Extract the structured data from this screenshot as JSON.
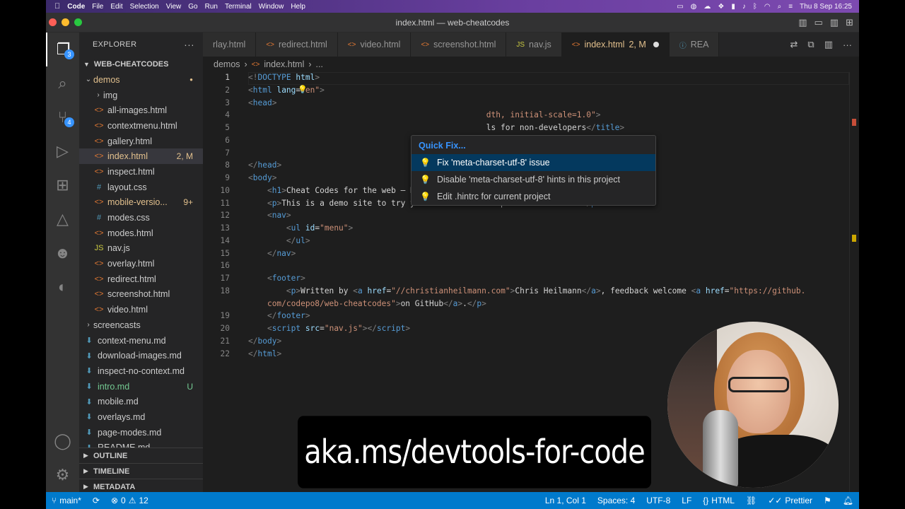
{
  "menubar": {
    "app": "Code",
    "items": [
      "File",
      "Edit",
      "Selection",
      "View",
      "Go",
      "Run",
      "Terminal",
      "Window",
      "Help"
    ],
    "clock": "Thu 8 Sep  16:25"
  },
  "window": {
    "title": "index.html — web-cheatcodes"
  },
  "activity": {
    "explorer_badge": "3",
    "scm_badge": "4"
  },
  "sidebar": {
    "title": "EXPLORER",
    "root": "WEB-CHEATCODES",
    "items": [
      {
        "label": "demos",
        "kind": "dir-open",
        "status": "dot"
      },
      {
        "label": "img",
        "kind": "dir"
      },
      {
        "label": "all-images.html",
        "kind": "html"
      },
      {
        "label": "contextmenu.html",
        "kind": "html"
      },
      {
        "label": "gallery.html",
        "kind": "html"
      },
      {
        "label": "index.html",
        "kind": "html",
        "status": "2, M"
      },
      {
        "label": "inspect.html",
        "kind": "html"
      },
      {
        "label": "layout.css",
        "kind": "css"
      },
      {
        "label": "mobile-versio...",
        "kind": "html",
        "status": "9+"
      },
      {
        "label": "modes.css",
        "kind": "css"
      },
      {
        "label": "modes.html",
        "kind": "html"
      },
      {
        "label": "nav.js",
        "kind": "js"
      },
      {
        "label": "overlay.html",
        "kind": "html"
      },
      {
        "label": "redirect.html",
        "kind": "html"
      },
      {
        "label": "screenshot.html",
        "kind": "html"
      },
      {
        "label": "video.html",
        "kind": "html"
      },
      {
        "label": "screencasts",
        "kind": "dir"
      },
      {
        "label": "context-menu.md",
        "kind": "md"
      },
      {
        "label": "download-images.md",
        "kind": "md"
      },
      {
        "label": "inspect-no-context.md",
        "kind": "md"
      },
      {
        "label": "intro.md",
        "kind": "md",
        "status": "U"
      },
      {
        "label": "mobile.md",
        "kind": "md"
      },
      {
        "label": "overlays.md",
        "kind": "md"
      },
      {
        "label": "page-modes.md",
        "kind": "md"
      },
      {
        "label": "README.md",
        "kind": "md"
      }
    ],
    "sections": [
      "OUTLINE",
      "TIMELINE",
      "METADATA"
    ]
  },
  "tabs": [
    {
      "label": "rlay.html",
      "kind": "html"
    },
    {
      "label": "redirect.html",
      "kind": "html"
    },
    {
      "label": "video.html",
      "kind": "html"
    },
    {
      "label": "screenshot.html",
      "kind": "html"
    },
    {
      "label": "nav.js",
      "kind": "js"
    },
    {
      "label": "index.html",
      "kind": "html",
      "status": "2, M",
      "active": true
    },
    {
      "label": "REA",
      "kind": "md"
    }
  ],
  "breadcrumb": [
    "demos",
    "index.html",
    "..."
  ],
  "quickfix": {
    "title": "Quick Fix...",
    "items": [
      "Fix 'meta-charset-utf-8' issue",
      "Disable 'meta-charset-utf-8' hints in this project",
      "Edit .hintrc for current project"
    ]
  },
  "code": {
    "lines": [
      [
        [
          "pn",
          "<!"
        ],
        [
          "tg",
          "DOCTYPE"
        ],
        [
          "tx",
          " "
        ],
        [
          "at",
          "html"
        ],
        [
          "pn",
          ">"
        ]
      ],
      [
        [
          "pn",
          "<"
        ],
        [
          "tg",
          "html"
        ],
        [
          "tx",
          " "
        ],
        [
          "at",
          "lang"
        ],
        [
          "tx",
          "="
        ],
        [
          "st",
          "\"en\""
        ],
        [
          "pn",
          ">"
        ]
      ],
      [
        [
          "pn",
          "<"
        ],
        [
          "tg",
          "head"
        ],
        [
          "pn",
          ">"
        ]
      ],
      [
        [
          "tx",
          "                                                  "
        ],
        [
          "st",
          "dth, initial-scale=1.0\""
        ],
        [
          "pn",
          ">"
        ]
      ],
      [
        [
          "tx",
          "                                                  "
        ],
        [
          "tx",
          "ls for non-developers"
        ],
        [
          "pn",
          "</"
        ],
        [
          "tg",
          "title"
        ],
        [
          "pn",
          ">"
        ]
      ],
      [
        [
          "tx",
          ""
        ]
      ],
      [
        [
          "tx",
          ""
        ]
      ],
      [
        [
          "pn",
          "</"
        ],
        [
          "tg",
          "head"
        ],
        [
          "pn",
          ">"
        ]
      ],
      [
        [
          "pn",
          "<"
        ],
        [
          "tg",
          "body"
        ],
        [
          "pn",
          ">"
        ]
      ],
      [
        [
          "tx",
          "    "
        ],
        [
          "pn",
          "<"
        ],
        [
          "tg",
          "h1"
        ],
        [
          "pn",
          ">"
        ],
        [
          "tx",
          "Cheat Codes for the web – Developer Tools for non-developers"
        ],
        [
          "pn",
          "</"
        ],
        [
          "tg",
          "h1"
        ],
        [
          "pn",
          ">"
        ]
      ],
      [
        [
          "tx",
          "    "
        ],
        [
          "pn",
          "<"
        ],
        [
          "tg",
          "p"
        ],
        [
          "pn",
          ">"
        ],
        [
          "tx",
          "This is a demo site to try your browser developer tools skills."
        ],
        [
          "pn",
          "</"
        ],
        [
          "tg",
          "p"
        ],
        [
          "pn",
          ">"
        ]
      ],
      [
        [
          "tx",
          "    "
        ],
        [
          "pn",
          "<"
        ],
        [
          "tg",
          "nav"
        ],
        [
          "pn",
          ">"
        ]
      ],
      [
        [
          "tx",
          "        "
        ],
        [
          "pn",
          "<"
        ],
        [
          "tg",
          "ul"
        ],
        [
          "tx",
          " "
        ],
        [
          "at",
          "id"
        ],
        [
          "tx",
          "="
        ],
        [
          "st",
          "\"menu\""
        ],
        [
          "pn",
          ">"
        ]
      ],
      [
        [
          "tx",
          "        "
        ],
        [
          "pn",
          "</"
        ],
        [
          "tg",
          "ul"
        ],
        [
          "pn",
          ">"
        ]
      ],
      [
        [
          "tx",
          "    "
        ],
        [
          "pn",
          "</"
        ],
        [
          "tg",
          "nav"
        ],
        [
          "pn",
          ">"
        ]
      ],
      [
        [
          "tx",
          ""
        ]
      ],
      [
        [
          "tx",
          "    "
        ],
        [
          "pn",
          "<"
        ],
        [
          "tg",
          "footer"
        ],
        [
          "pn",
          ">"
        ]
      ],
      [
        [
          "tx",
          "        "
        ],
        [
          "pn",
          "<"
        ],
        [
          "tg",
          "p"
        ],
        [
          "pn",
          ">"
        ],
        [
          "tx",
          "Written by "
        ],
        [
          "pn",
          "<"
        ],
        [
          "tg",
          "a"
        ],
        [
          "tx",
          " "
        ],
        [
          "at",
          "href"
        ],
        [
          "tx",
          "="
        ],
        [
          "st",
          "\"//christianheilmann.com\""
        ],
        [
          "pn",
          ">"
        ],
        [
          "tx",
          "Chris Heilmann"
        ],
        [
          "pn",
          "</"
        ],
        [
          "tg",
          "a"
        ],
        [
          "pn",
          ">"
        ],
        [
          "tx",
          ", feedback welcome "
        ],
        [
          "pn",
          "<"
        ],
        [
          "tg",
          "a"
        ],
        [
          "tx",
          " "
        ],
        [
          "at",
          "href"
        ],
        [
          "tx",
          "="
        ],
        [
          "st",
          "\"https://github."
        ]
      ],
      [
        [
          "tx",
          "    "
        ],
        [
          "st",
          "com/codepo8/web-cheatcodes\""
        ],
        [
          "pn",
          ">"
        ],
        [
          "tx",
          "on GitHub"
        ],
        [
          "pn",
          "</"
        ],
        [
          "tg",
          "a"
        ],
        [
          "pn",
          ">"
        ],
        [
          "tx",
          "."
        ],
        [
          "pn",
          "</"
        ],
        [
          "tg",
          "p"
        ],
        [
          "pn",
          ">"
        ]
      ],
      [
        [
          "tx",
          "    "
        ],
        [
          "pn",
          "</"
        ],
        [
          "tg",
          "footer"
        ],
        [
          "pn",
          ">"
        ]
      ],
      [
        [
          "tx",
          "    "
        ],
        [
          "pn",
          "<"
        ],
        [
          "tg",
          "script"
        ],
        [
          "tx",
          " "
        ],
        [
          "at",
          "src"
        ],
        [
          "tx",
          "="
        ],
        [
          "st",
          "\"nav.js\""
        ],
        [
          "pn",
          "></"
        ],
        [
          "tg",
          "script"
        ],
        [
          "pn",
          ">"
        ]
      ],
      [
        [
          "pn",
          "</"
        ],
        [
          "tg",
          "body"
        ],
        [
          "pn",
          ">"
        ]
      ],
      [
        [
          "pn",
          "</"
        ],
        [
          "tg",
          "html"
        ],
        [
          "pn",
          ">"
        ]
      ]
    ],
    "line_numbers": [
      "1",
      "2",
      "3",
      "4",
      "5",
      "6",
      "7",
      "8",
      "9",
      "10",
      "11",
      "12",
      "13",
      "14",
      "15",
      "16",
      "17",
      "18",
      "",
      "19",
      "20",
      "21",
      "22"
    ]
  },
  "statusbar": {
    "branch": "main*",
    "errors": "0",
    "warnings": "12",
    "position": "Ln 1, Col 1",
    "spaces": "Spaces: 4",
    "encoding": "UTF-8",
    "eol": "LF",
    "language": "HTML",
    "formatter": "Prettier"
  },
  "caption": "aka.ms/devtools-for-code",
  "colors": {
    "accent": "#007acc",
    "modified": "#e2c08d",
    "untracked": "#73c991",
    "quickfix_title": "#3794ff"
  }
}
